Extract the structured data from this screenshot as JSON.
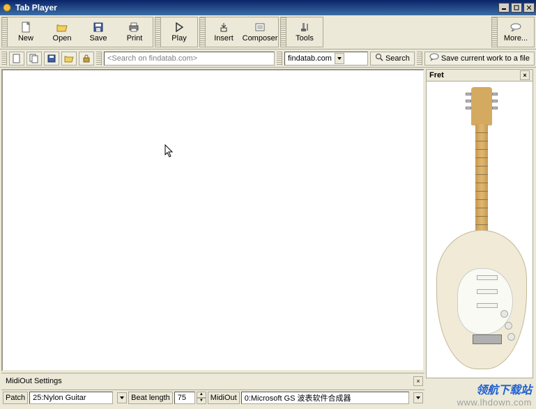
{
  "window": {
    "title": "Tab Player"
  },
  "toolbar": {
    "new": "New",
    "open": "Open",
    "save": "Save",
    "print": "Print",
    "play": "Play",
    "insert": "Insert",
    "composer": "Composer",
    "tools": "Tools",
    "more": "More..."
  },
  "search": {
    "placeholder": "<Search on findatab.com>",
    "site": "findatab.com",
    "button": "Search",
    "save_work": "Save current work to a file"
  },
  "fret": {
    "title": "Fret"
  },
  "midiout": {
    "title": "MidiOut Settings",
    "patch_label": "Patch",
    "patch_value": "25:Nylon Guitar",
    "beat_label": "Beat length",
    "beat_value": "75",
    "out_label": "MidiOut",
    "out_value": "0:Microsoft GS 波表软件合成器"
  },
  "watermark": {
    "title": "领航下载站",
    "url": "www.lhdown.com"
  }
}
